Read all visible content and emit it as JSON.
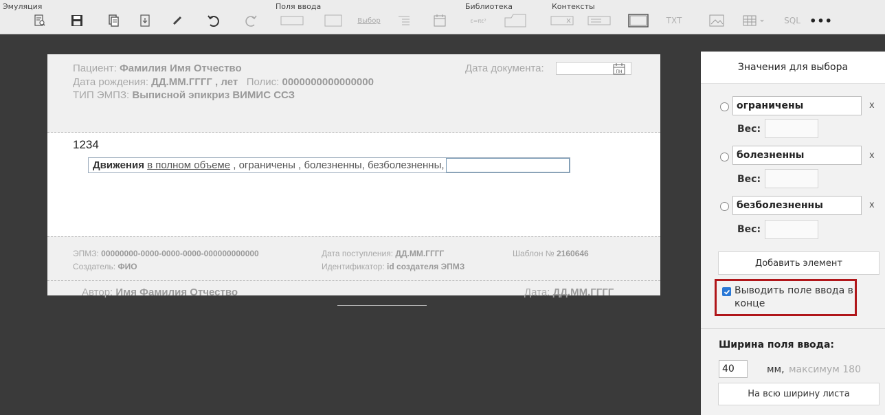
{
  "toolbar": {
    "groups": {
      "emulation": "Эмуляция",
      "input_fields": "Поля ввода",
      "library": "Библиотека",
      "contexts": "Контексты"
    },
    "select_label": "Выбор",
    "formula_label": "ε=πε²",
    "cal_label": "ПН",
    "txt_label": "TXT",
    "sql_label": "SQL",
    "more_label": "•••"
  },
  "document": {
    "patient_label": "Пациент:",
    "patient_value": "Фамилия Имя Отчество",
    "dob_label": "Дата рождения:",
    "dob_value": "ДД.ММ.ГГГГ , лет",
    "policy_label": "Полис:",
    "policy_value": "0000000000000000",
    "type_label": "ТИП ЭМПЗ:",
    "type_value": "Выписной эпикриз ВИМИС ССЗ",
    "doc_date_label": "Дата документа:",
    "cal_label": "ПН",
    "field_value": "1234",
    "movement_label": "Движения",
    "movement_link": "в полном объеме",
    "movement_rest": ", ограничены , болезненны, безболезненны,",
    "epmz_label": "ЭПМЗ:",
    "epmz_value": "00000000-0000-0000-0000-000000000000",
    "creator_label": "Создатель:",
    "creator_value": "ФИО",
    "admission_label": "Дата поступления:",
    "admission_value": "ДД.ММ.ГГГГ",
    "identifier_label": "Идентификатор:",
    "identifier_value": "id создателя ЭПМЗ",
    "template_label": "Шаблон №",
    "template_value": "2160646",
    "author_label": "Автор:",
    "author_value": "Имя Фамилия Отчество",
    "date_label": "Дата:",
    "date_value": "ДД.ММ.ГГГГ"
  },
  "panel": {
    "title": "Значения для выбора",
    "options": [
      {
        "value": "ограничены",
        "remove": "x",
        "weight_label": "Вес:"
      },
      {
        "value": "болезненны",
        "remove": "x",
        "weight_label": "Вес:"
      },
      {
        "value": "безболезненны",
        "remove": "x",
        "weight_label": "Вес:"
      }
    ],
    "add_button": "Добавить элемент",
    "checkbox_label": "Выводить поле ввода в конце",
    "checkbox_checked": true,
    "width_title": "Ширина поля ввода:",
    "width_value": "40",
    "width_unit": "мм,",
    "width_max": "максимум 180",
    "full_width_button": "На всю ширину листа"
  },
  "colors": {
    "highlight_border": "#b0161a",
    "checkbox": "#2a78d6"
  }
}
